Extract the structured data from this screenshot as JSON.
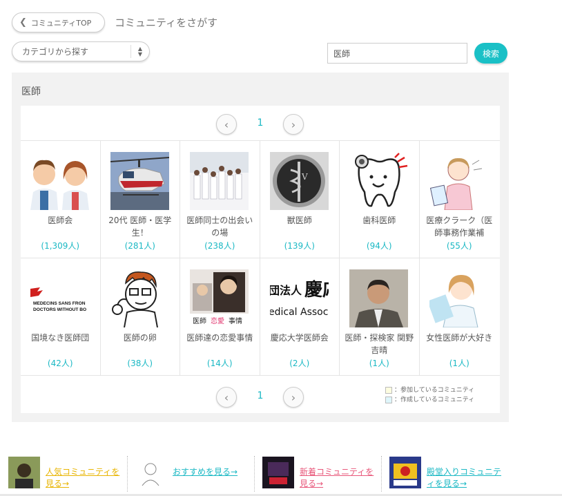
{
  "header": {
    "back_label": "コミュニティTOP",
    "title": "コミュニティをさがす"
  },
  "search": {
    "category_label": "カテゴリから探す",
    "query": "医師",
    "button_label": "検索"
  },
  "results": {
    "heading": "医師",
    "page": "1",
    "communities": [
      {
        "name": "医師会",
        "count": "(1,309人)",
        "icon": "doctor-couple-icon"
      },
      {
        "name": "20代 医師・医学生！",
        "count": "(281人)",
        "icon": "helicopter-icon"
      },
      {
        "name": "医師同士の出会いの場",
        "count": "(238人)",
        "icon": "doctor-group-icon"
      },
      {
        "name": "獣医師",
        "count": "(139人)",
        "icon": "vet-emblem-icon"
      },
      {
        "name": "歯科医師",
        "count": "(94人)",
        "icon": "tooth-icon"
      },
      {
        "name": "医療クラーク（医師事務作業補",
        "count": "(55人)",
        "icon": "nurse-icon"
      },
      {
        "name": "国境なき医師団",
        "count": "(42人)",
        "icon": "msf-logo-icon"
      },
      {
        "name": "医師の卵",
        "count": "(38人)",
        "icon": "cartoon-doctor-icon"
      },
      {
        "name": "医師達の恋愛事情",
        "count": "(14人)",
        "icon": "drama-poster-icon"
      },
      {
        "name": "慶応大学医師会",
        "count": "(2人)",
        "icon": "keio-text-icon"
      },
      {
        "name": "医師・探検家 関野吉晴",
        "count": "(1人)",
        "icon": "portrait-icon"
      },
      {
        "name": "女性医師が大好き",
        "count": "(1人)",
        "icon": "female-doctor-icon"
      }
    ],
    "msf_text": [
      "MEDECINS SANS FRON",
      "DOCTORS WITHOUT BO"
    ],
    "keio_text": [
      "団法人",
      "慶応",
      "edical Assoc"
    ]
  },
  "legend": {
    "joined": "：参加しているコミュニティ",
    "created": "：作成しているコミュニティ",
    "joined_color": "#fdfde0",
    "created_color": "#dff6fb"
  },
  "footer": [
    {
      "label": "人気コミュニティを見る→",
      "color": "#e8b400"
    },
    {
      "label": "おすすめを見る→",
      "color": "#1ab8c4"
    },
    {
      "label": "新着コミュニティを見る→",
      "color": "#e8577a"
    },
    {
      "label": "殿堂入りコミュニティを見る→",
      "color": "#1ab8c4"
    }
  ]
}
